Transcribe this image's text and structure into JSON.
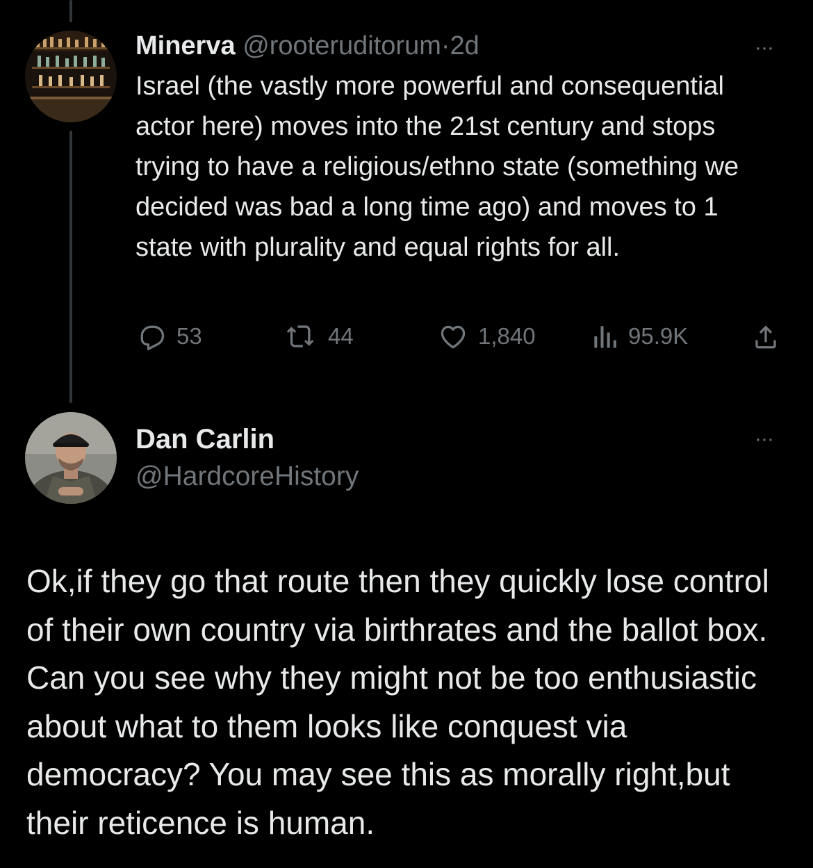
{
  "tweets": [
    {
      "author": {
        "name": "Minerva",
        "handle": "@rooteruditorum",
        "separator": "·",
        "time": "2d"
      },
      "text": "Israel (the vastly more powerful and consequential actor here) moves into the 21st century and stops trying to have a religious/ethno state (something we decided was bad a long time ago) and moves to 1 state with plurality and equal rights for all.",
      "stats": {
        "replies": "53",
        "retweets": "44",
        "likes": "1,840",
        "views": "95.9K"
      },
      "more_label": "···"
    },
    {
      "author": {
        "name": "Dan Carlin",
        "handle": "@HardcoreHistory"
      },
      "text": "Ok,if they go that route then they quickly lose control of their own country via birthrates and the ballot box. Can you see why they might not be too enthusiastic about what to them looks like conquest via democracy? You may see this as morally right,but their reticence is human.",
      "more_label": "···"
    }
  ],
  "icons": {
    "reply": "reply-icon",
    "retweet": "retweet-icon",
    "like": "heart-icon",
    "views": "views-bar-chart-icon",
    "share": "share-icon",
    "more": "more-horizontal-icon"
  },
  "colors": {
    "background": "#000000",
    "text": "#e7e9ea",
    "secondary": "#71767b",
    "thread_line": "#333639"
  }
}
